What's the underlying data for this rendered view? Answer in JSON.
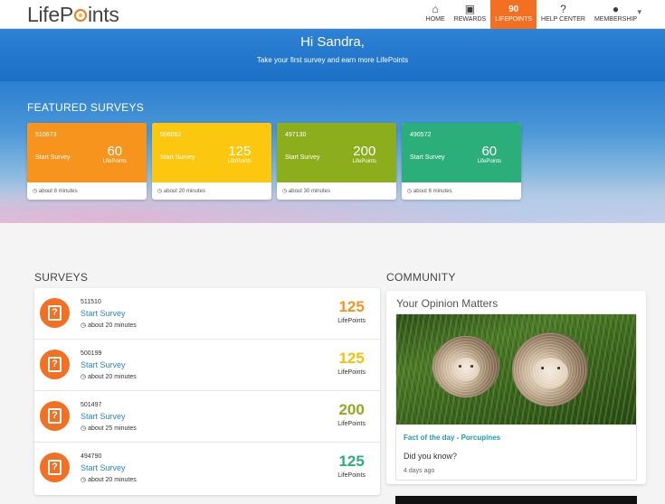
{
  "brand": {
    "logo_left": "LifeP",
    "logo_right": "ints"
  },
  "nav": {
    "items": [
      {
        "label": "HOME",
        "icon": "⌂"
      },
      {
        "label": "REWARDS",
        "icon": "▣"
      },
      {
        "label": "LIFEPOINTS",
        "value": "90"
      },
      {
        "label": "HELP CENTER",
        "icon": "?"
      },
      {
        "label": "MEMBERSHIP",
        "icon": "●"
      }
    ],
    "caret": "▾"
  },
  "hero": {
    "greeting": "Hi Sandra,",
    "subtitle": "Take your first survey and earn more LifePoints"
  },
  "featured": {
    "title": "FEATURED SURVEYS",
    "cards": [
      {
        "id": "510673",
        "start": "Start Survey",
        "points": "60",
        "points_label": "LifePoints",
        "duration": "about 8 minutes",
        "color": "#f7941d"
      },
      {
        "id": "506062",
        "start": "Start Survey",
        "points": "125",
        "points_label": "LifePoints",
        "duration": "about 20 minutes",
        "color": "#fcc70f"
      },
      {
        "id": "497130",
        "start": "Start Survey",
        "points": "200",
        "points_label": "LifePoints",
        "duration": "about 30 minutes",
        "color": "#8cae1c"
      },
      {
        "id": "490572",
        "start": "Start Survey",
        "points": "60",
        "points_label": "LifePoints",
        "duration": "about 6 minutes",
        "color": "#2cae7b"
      }
    ]
  },
  "surveys": {
    "title": "SURVEYS",
    "rows": [
      {
        "id": "511510",
        "start": "Start Survey",
        "duration": "about 20 minutes",
        "points": "125",
        "points_label": "LifePoints",
        "color": "#f7941d"
      },
      {
        "id": "500199",
        "start": "Start Survey",
        "duration": "about 20 minutes",
        "points": "125",
        "points_label": "LifePoints",
        "color": "#f4c20d"
      },
      {
        "id": "501497",
        "start": "Start Survey",
        "duration": "about 25 minutes",
        "points": "200",
        "points_label": "LifePoints",
        "color": "#8cae1c"
      },
      {
        "id": "494790",
        "start": "Start Survey",
        "duration": "about 20 minutes",
        "points": "125",
        "points_label": "LifePoints",
        "color": "#2cae7b"
      }
    ]
  },
  "community": {
    "title": "COMMUNITY",
    "card_title": "Your Opinion Matters",
    "fact": "Fact of the day - Porcupines",
    "question": "Did you know?",
    "ago": "4 days ago"
  },
  "icons": {
    "clock": "clock-icon",
    "question": "question-icon"
  }
}
